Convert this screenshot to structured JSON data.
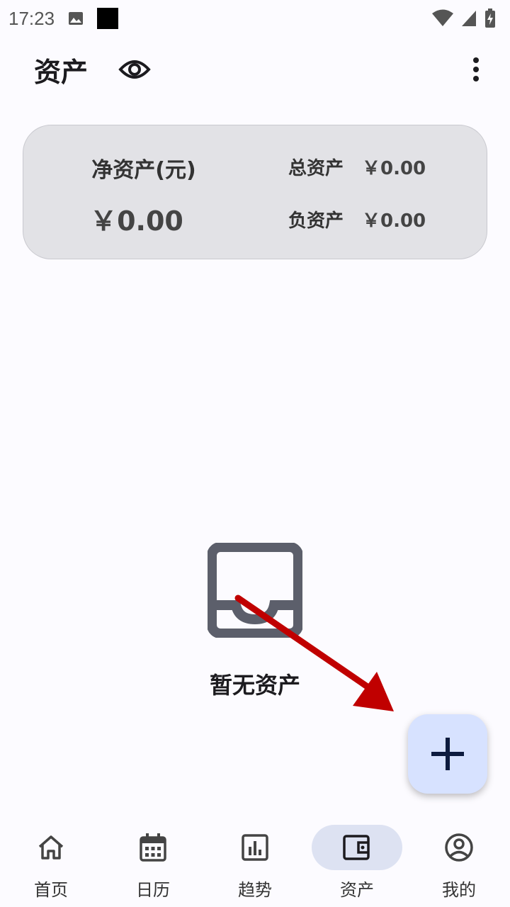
{
  "status_bar": {
    "time": "17:23",
    "icons": [
      "image-icon",
      "black-square-icon",
      "wifi-icon",
      "signal-icon",
      "battery-charging-icon"
    ]
  },
  "app_bar": {
    "title": "资产",
    "icons": [
      "eye-icon",
      "more-vert-icon"
    ]
  },
  "summary": {
    "net_label": "净资产(元)",
    "net_value": "￥0.00",
    "total_label": "总资产",
    "total_value": "￥0.00",
    "debt_label": "负资产",
    "debt_value": "￥0.00"
  },
  "empty_state": {
    "icon": "inbox-icon",
    "text": "暂无资产"
  },
  "fab": {
    "icon": "plus-icon"
  },
  "bottom_nav": {
    "active_index": 3,
    "items": [
      {
        "label": "首页",
        "icon": "home-icon"
      },
      {
        "label": "日历",
        "icon": "calendar-icon"
      },
      {
        "label": "趋势",
        "icon": "chart-icon"
      },
      {
        "label": "资产",
        "icon": "wallet-icon"
      },
      {
        "label": "我的",
        "icon": "account-circle-icon"
      }
    ]
  },
  "colors": {
    "background": "#fcfbff",
    "card": "#e2e2e6",
    "fab": "#d7e2ff",
    "nav_active_pill": "#dde2f2",
    "empty_icon": "#5c5f6b",
    "annotation_arrow": "#c00000"
  }
}
